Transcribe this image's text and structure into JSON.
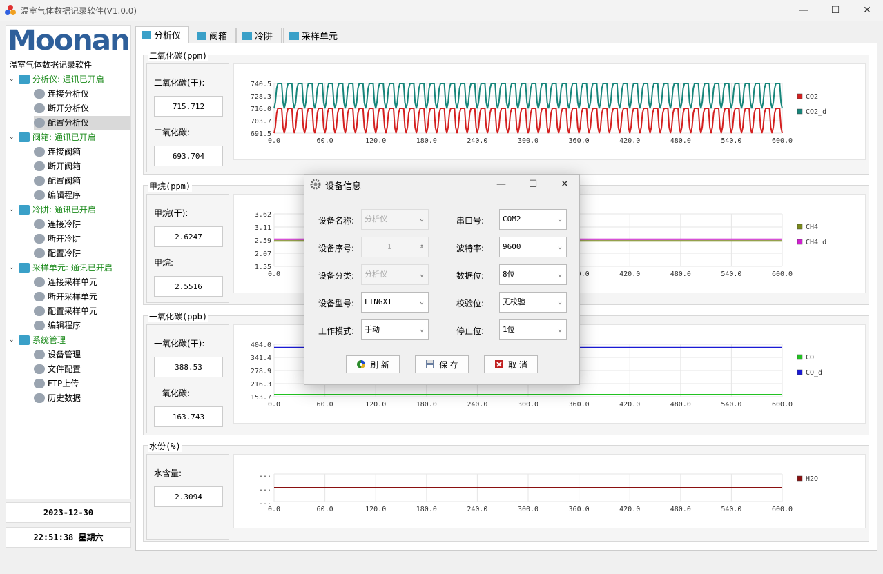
{
  "window": {
    "title": "温室气体数据记录软件(V1.0.0)"
  },
  "sidebar": {
    "logo_text": "Moonan",
    "subtitle": "温室气体数据记录软件",
    "tree": [
      {
        "label": "分析仪: 通讯已开启",
        "group": true
      },
      {
        "label": "连接分析仪"
      },
      {
        "label": "断开分析仪"
      },
      {
        "label": "配置分析仪",
        "selected": true
      },
      {
        "label": "阀箱: 通讯已开启",
        "group": true
      },
      {
        "label": "连接阀箱"
      },
      {
        "label": "断开阀箱"
      },
      {
        "label": "配置阀箱"
      },
      {
        "label": "编辑程序"
      },
      {
        "label": "冷阱: 通讯已开启",
        "group": true
      },
      {
        "label": "连接冷阱"
      },
      {
        "label": "断开冷阱"
      },
      {
        "label": "配置冷阱"
      },
      {
        "label": "采样单元: 通讯已开启",
        "group": true
      },
      {
        "label": "连接采样单元"
      },
      {
        "label": "断开采样单元"
      },
      {
        "label": "配置采样单元"
      },
      {
        "label": "编辑程序"
      },
      {
        "label": "系统管理",
        "group": true
      },
      {
        "label": "设备管理"
      },
      {
        "label": "文件配置"
      },
      {
        "label": "FTP上传"
      },
      {
        "label": "历史数据"
      }
    ],
    "date": "2023-12-30",
    "time": "22:51:38 星期六"
  },
  "tabs": [
    {
      "label": "分析仪",
      "active": true
    },
    {
      "label": "阀箱"
    },
    {
      "label": "冷阱"
    },
    {
      "label": "采样单元"
    }
  ],
  "panels": [
    {
      "title": "二氧化碳(ppm)",
      "dry_label": "二氧化碳(干):",
      "dry_value": "715.712",
      "wet_label": "二氧化碳:",
      "wet_value": "693.704"
    },
    {
      "title": "甲烷(ppm)",
      "dry_label": "甲烷(干):",
      "dry_value": "2.6247",
      "wet_label": "甲烷:",
      "wet_value": "2.5516"
    },
    {
      "title": "一氧化碳(ppb)",
      "dry_label": "一氧化碳(干):",
      "dry_value": "388.53",
      "wet_label": "一氧化碳:",
      "wet_value": "163.743"
    },
    {
      "title": "水份(%)",
      "dry_label": "水含量:",
      "dry_value": "2.3094"
    }
  ],
  "chart_data": [
    {
      "type": "line",
      "x_ticks": [
        "0.0",
        "60.0",
        "120.0",
        "180.0",
        "240.0",
        "300.0",
        "360.0",
        "420.0",
        "480.0",
        "540.0",
        "600.0"
      ],
      "y_ticks": [
        "740.5",
        "728.3",
        "716.0",
        "703.7",
        "691.5"
      ],
      "xlim": [
        0,
        600
      ],
      "ylim": [
        691.5,
        740.5
      ],
      "series": [
        {
          "name": "CO2",
          "color": "#d42020",
          "min": 691.5,
          "max": 716.0,
          "periods": 50
        },
        {
          "name": "CO2_d",
          "color": "#16857a",
          "min": 716.0,
          "max": 740.5,
          "periods": 50
        }
      ]
    },
    {
      "type": "line",
      "x_ticks": [
        "0.0",
        "60.0",
        "120.0",
        "180.0",
        "240.0",
        "300.0",
        "360.0",
        "420.0",
        "480.0",
        "540.0",
        "600.0"
      ],
      "y_ticks": [
        "3.62",
        "3.11",
        "2.59",
        "2.07",
        "1.55"
      ],
      "xlim": [
        0,
        600
      ],
      "ylim": [
        1.55,
        3.62
      ],
      "series": [
        {
          "name": "CH4",
          "color": "#7a8a1a",
          "value": 2.55
        },
        {
          "name": "CH4_d",
          "color": "#d020d0",
          "value": 2.62
        }
      ]
    },
    {
      "type": "line",
      "x_ticks": [
        "0.0",
        "60.0",
        "120.0",
        "180.0",
        "240.0",
        "300.0",
        "360.0",
        "420.0",
        "480.0",
        "540.0",
        "600.0"
      ],
      "y_ticks": [
        "404.0",
        "341.4",
        "278.9",
        "216.3",
        "153.7"
      ],
      "xlim": [
        0,
        600
      ],
      "ylim": [
        153.7,
        404.0
      ],
      "series": [
        {
          "name": "CO",
          "color": "#22c222",
          "value": 163.7
        },
        {
          "name": "CO_d",
          "color": "#1a1ad4",
          "value": 388.5
        }
      ]
    },
    {
      "type": "line",
      "x_ticks": [
        "0.0",
        "60.0",
        "120.0",
        "180.0",
        "240.0",
        "300.0",
        "360.0",
        "420.0",
        "480.0",
        "540.0",
        "600.0"
      ],
      "y_ticks": [
        "...",
        "...",
        "..."
      ],
      "series": [
        {
          "name": "H2O",
          "color": "#8a1010",
          "value": 2.3094
        }
      ]
    }
  ],
  "dialog": {
    "title": "设备信息",
    "fields_left": [
      {
        "label": "设备名称:",
        "value": "分析仪",
        "disabled": true,
        "kind": "select"
      },
      {
        "label": "设备序号:",
        "value": "1",
        "disabled": true,
        "kind": "spin"
      },
      {
        "label": "设备分类:",
        "value": "分析仪",
        "disabled": true,
        "kind": "select"
      },
      {
        "label": "设备型号:",
        "value": "LINGXI",
        "kind": "select"
      },
      {
        "label": "工作模式:",
        "value": "手动",
        "kind": "select"
      }
    ],
    "fields_right": [
      {
        "label": "串口号:",
        "value": "COM2"
      },
      {
        "label": "波特率:",
        "value": "9600"
      },
      {
        "label": "数据位:",
        "value": "8位"
      },
      {
        "label": "校验位:",
        "value": "无校验"
      },
      {
        "label": "停止位:",
        "value": "1位"
      }
    ],
    "buttons": {
      "refresh": "刷 新",
      "save": "保 存",
      "cancel": "取 消"
    }
  }
}
